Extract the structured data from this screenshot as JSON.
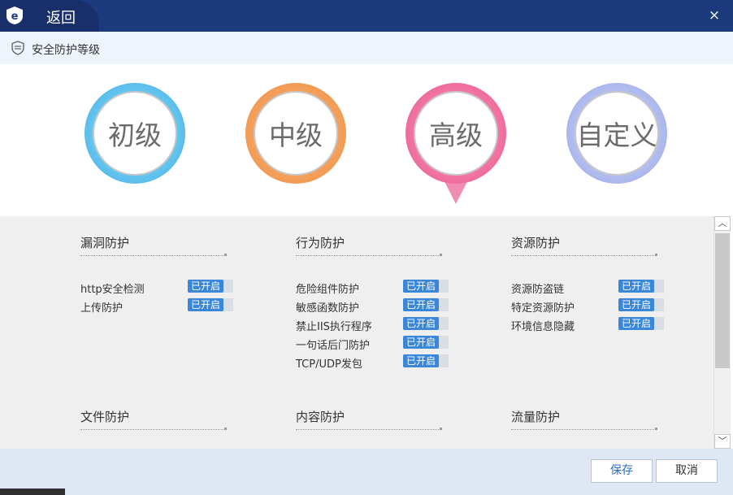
{
  "titlebar": {
    "back_label": "返回",
    "close_icon": "×"
  },
  "section": {
    "title": "安全防护等级"
  },
  "levels": [
    {
      "label": "初级",
      "color": "#3aa8e4"
    },
    {
      "label": "中级",
      "color": "#ee8a3a"
    },
    {
      "label": "高级",
      "color": "#e8508a",
      "selected": true
    },
    {
      "label": "自定义",
      "color": "#95a3e6"
    }
  ],
  "groups": [
    {
      "title": "漏洞防护",
      "items": [
        {
          "name": "http安全检测",
          "status": "已开启"
        },
        {
          "name": "上传防护",
          "status": "已开启"
        }
      ]
    },
    {
      "title": "行为防护",
      "items": [
        {
          "name": "危险组件防护",
          "status": "已开启"
        },
        {
          "name": "敏感函数防护",
          "status": "已开启"
        },
        {
          "name": "禁止IIS执行程序",
          "status": "已开启"
        },
        {
          "name": "一句话后门防护",
          "status": "已开启"
        },
        {
          "name": "TCP/UDP发包",
          "status": "已开启"
        }
      ]
    },
    {
      "title": "资源防护",
      "items": [
        {
          "name": "资源防盗链",
          "status": "已开启"
        },
        {
          "name": "特定资源防护",
          "status": "已开启"
        },
        {
          "name": "环境信息隐藏",
          "status": "已开启"
        }
      ]
    },
    {
      "title": "文件防护",
      "items": []
    },
    {
      "title": "内容防护",
      "items": []
    },
    {
      "title": "流量防护",
      "items": []
    }
  ],
  "scrollbar": {
    "up_icon": "︿",
    "down_icon": "﹀"
  },
  "footer": {
    "save_label": "保存",
    "cancel_label": "取消"
  },
  "colors": {
    "titlebar": "#1c3a7c",
    "badge": "#3a86d8",
    "accent_text": "#2a6bc4"
  }
}
